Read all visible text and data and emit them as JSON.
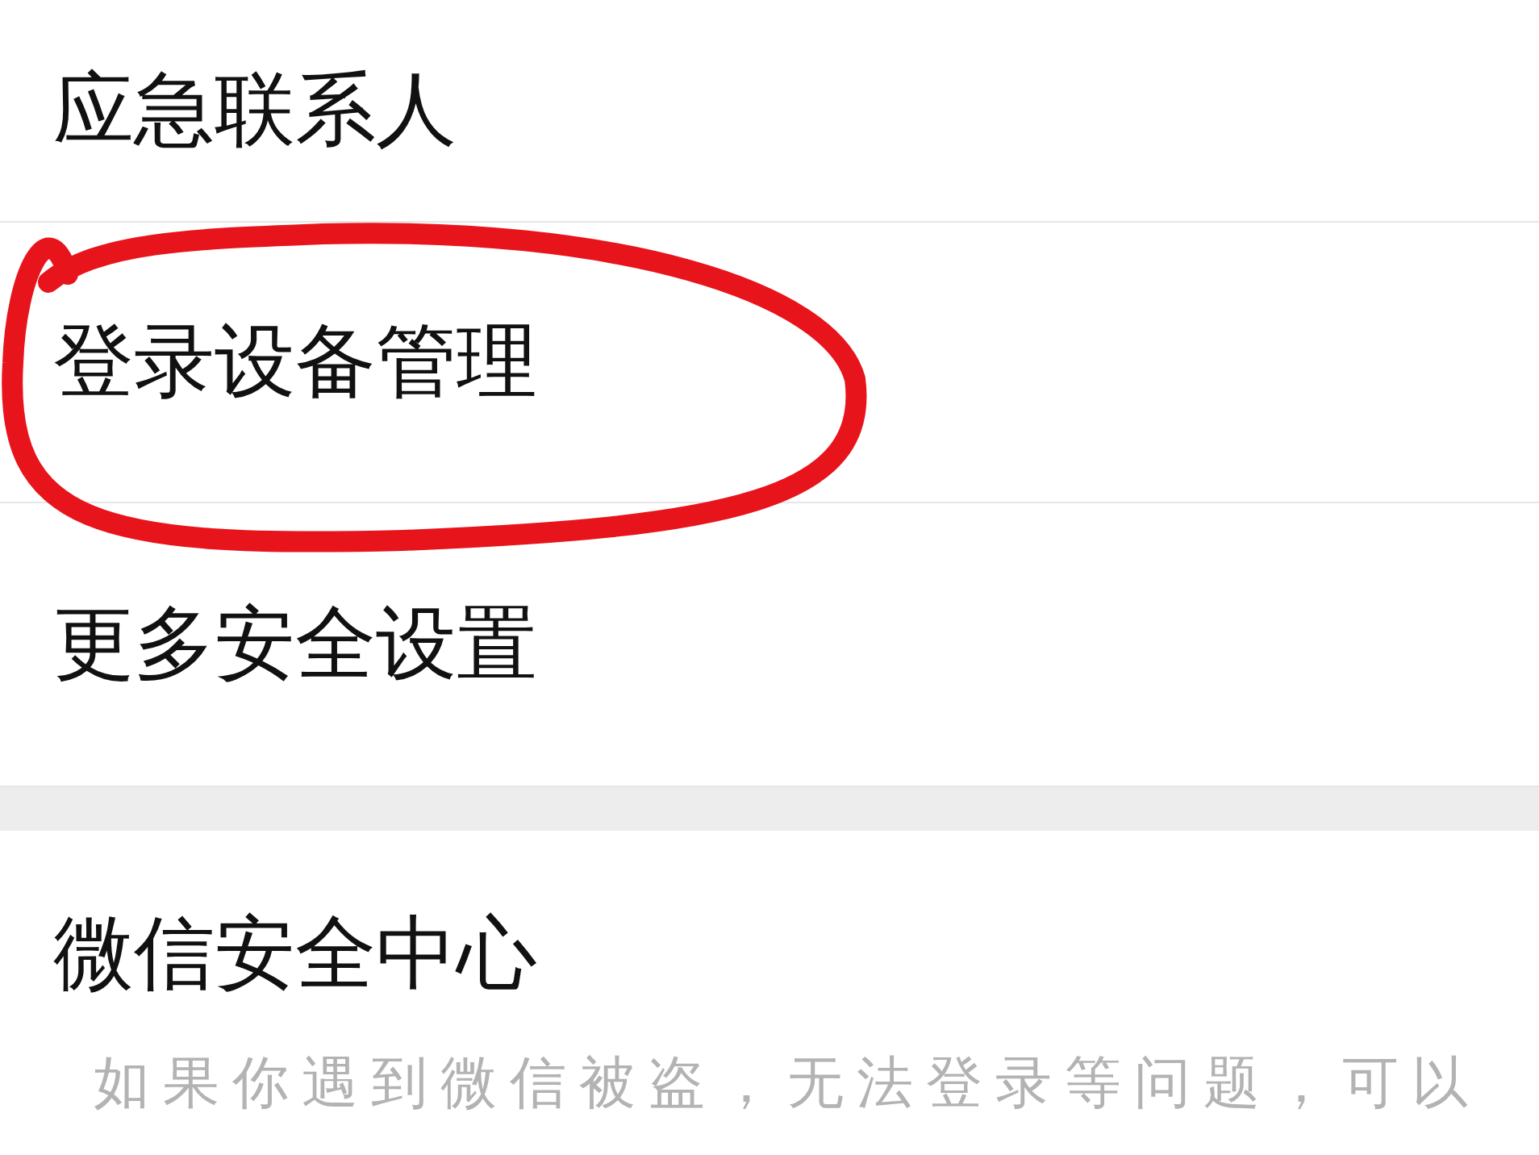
{
  "settings_items": [
    {
      "label": "应急联系人",
      "highlighted": false
    },
    {
      "label": "登录设备管理",
      "highlighted": true
    },
    {
      "label": "更多安全设置",
      "highlighted": false
    }
  ],
  "security_center": {
    "title": "微信安全中心",
    "description": "如果你遇到微信被盗，无法登录等问题，可以"
  }
}
